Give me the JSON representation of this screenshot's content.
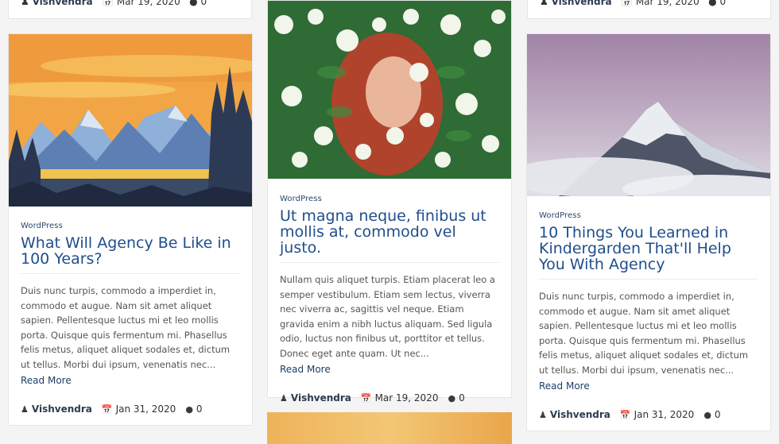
{
  "cards": [
    {
      "category": "WordPress",
      "title": "What Will Agency Be Like in 100 Years?",
      "excerpt": "Duis nunc turpis, commodo a imperdiet in, commodo et augue. Nam sit amet aliquet sapien. Pellentesque luctus mi et leo mollis porta. Quisque quis fermentum mi. Phasellus felis metus, aliquet aliquet sodales et, dictum ut tellus. Morbi dui ipsum, venenatis nec...",
      "read_more": "Read More",
      "author": "Vishvendra",
      "date": "Jan 31, 2020",
      "comments": "0"
    },
    {
      "category": "WordPress",
      "title": "Ut magna neque, finibus ut mollis at, commodo vel justo.",
      "excerpt": "Nullam quis aliquet turpis. Etiam placerat leo a semper vestibulum. Etiam sem lectus, viverra nec viverra ac, sagittis vel neque. Etiam gravida enim a nibh luctus aliquam. Sed ligula odio, luctus non finibus ut, porttitor et tellus. Donec eget ante quam. Ut nec...",
      "read_more": "Read More",
      "author": "Vishvendra",
      "date": "Mar 19, 2020",
      "comments": "0"
    },
    {
      "category": "WordPress",
      "title": "10 Things You Learned in Kindergarden That'll Help You With Agency",
      "excerpt": "Duis nunc turpis, commodo a imperdiet in, commodo et augue. Nam sit amet aliquet sapien. Pellentesque luctus mi et leo mollis porta. Quisque quis fermentum mi. Phasellus felis metus, aliquet aliquet sodales et, dictum ut tellus. Morbi dui ipsum, venenatis nec...",
      "read_more": "Read More",
      "author": "Vishvendra",
      "date": "Jan 31, 2020",
      "comments": "0"
    }
  ],
  "top_partial": [
    {
      "author": "Vishvendra",
      "date": "Mar 19, 2020",
      "comments": "0"
    },
    {
      "author": "Vishvendra",
      "date": "Mar 19, 2020",
      "comments": "0"
    }
  ],
  "icons": {
    "author": "user-icon",
    "date": "calendar-icon",
    "comments": "comment-icon"
  }
}
